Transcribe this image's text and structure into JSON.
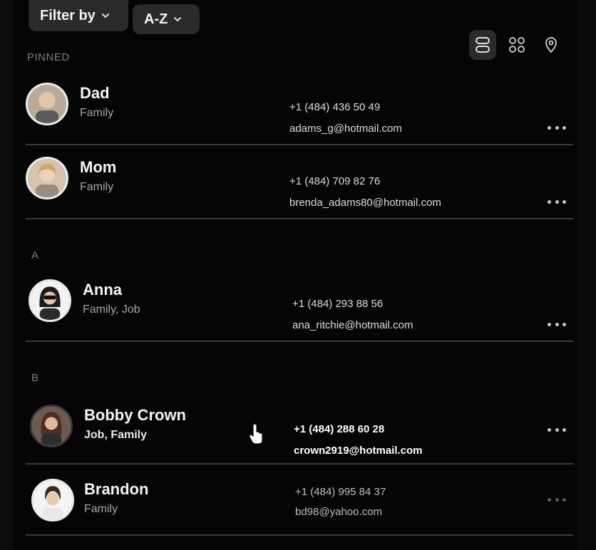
{
  "toolbar": {
    "filter_label": "Filter by",
    "sort_label": "A-Z"
  },
  "view_modes": [
    {
      "name": "list-view-icon",
      "active": true
    },
    {
      "name": "grid-view-icon",
      "active": false
    },
    {
      "name": "map-view-icon",
      "active": false
    }
  ],
  "sections": {
    "pinned": "PINNED",
    "a": "A",
    "b": "B"
  },
  "contacts": [
    {
      "name": "Dad",
      "tags": "Family",
      "phone": "+1 (484) 436 50 49",
      "email": "adams_g@hotmail.com"
    },
    {
      "name": "Mom",
      "tags": "Family",
      "phone": "+1 (484) 709 82 76",
      "email": "brenda_adams80@hotmail.com"
    },
    {
      "name": "Anna",
      "tags": "Family, Job",
      "phone": "+1 (484) 293 88 56",
      "email": "ana_ritchie@hotmail.com"
    },
    {
      "name": "Bobby Crown",
      "tags": "Job, Family",
      "phone": "+1 (484) 288 60 28",
      "email": "crown2919@hotmail.com"
    },
    {
      "name": "Brandon",
      "tags": "Family",
      "phone": "+1 (484) 995 84 37",
      "email": "bd98@yahoo.com"
    }
  ],
  "colors": {
    "background": "#050505",
    "button": "#2a2a2a",
    "muted_text": "#a6a6a6",
    "divider": "#3a3a3a"
  }
}
